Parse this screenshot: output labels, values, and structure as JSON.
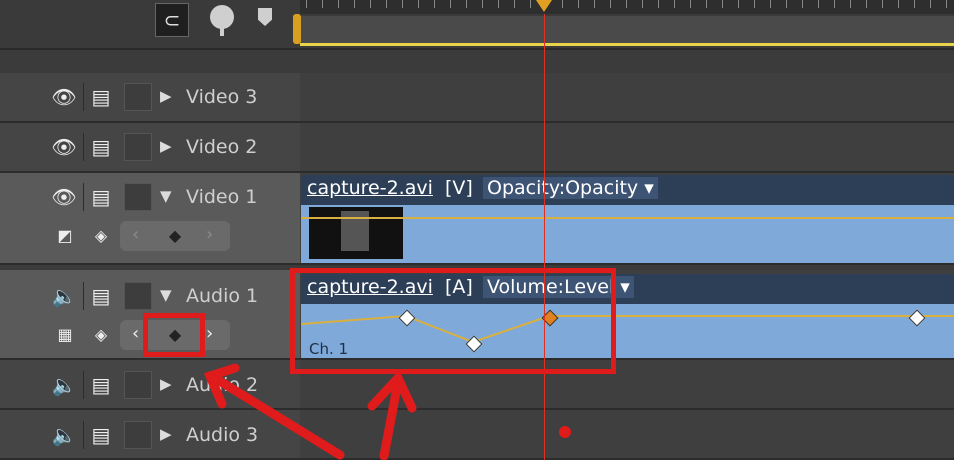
{
  "toolbar": {
    "snap_icon": "snap-icon",
    "marker_icon": "add-marker-icon",
    "flag_icon": "keyframe-flag-icon"
  },
  "tracks": [
    {
      "name": "Video 3",
      "kind": "video",
      "expanded": false
    },
    {
      "name": "Video 2",
      "kind": "video",
      "expanded": false
    },
    {
      "name": "Video 1",
      "kind": "video",
      "expanded": true
    },
    {
      "name": "Audio 1",
      "kind": "audio",
      "expanded": true
    },
    {
      "name": "Audio 2",
      "kind": "audio",
      "expanded": false
    },
    {
      "name": "Audio 3",
      "kind": "audio",
      "expanded": false
    }
  ],
  "video_clip": {
    "name": "capture-2.avi",
    "type": "[V]",
    "property": "Opacity:Opacity ▾"
  },
  "audio_clip": {
    "name": "capture-2.avi",
    "type": "[A]",
    "property": "Volume:Level ▾",
    "channel": "Ch. 1"
  },
  "colors": {
    "clip_body": "#7fa9d8",
    "clip_header": "#2d3f57",
    "playhead": "#e03020",
    "annotation": "#e01b1b",
    "work_area": "#e8d44a"
  }
}
